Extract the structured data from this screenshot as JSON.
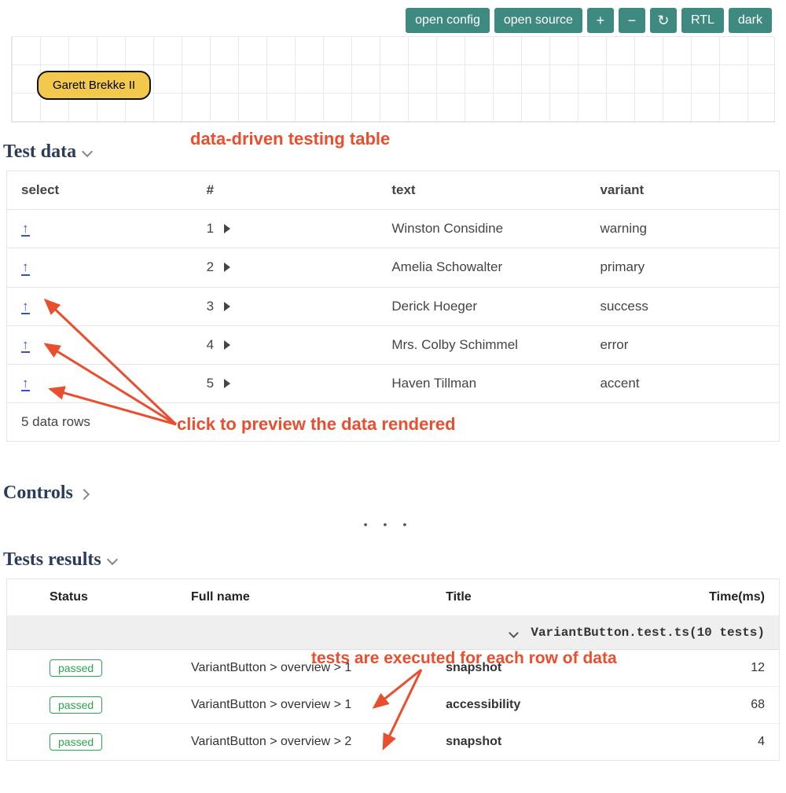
{
  "toolbar": {
    "open_config": "open config",
    "open_source": "open source",
    "plus": "+",
    "minus": "−",
    "reload": "↻",
    "rtl": "RTL",
    "dark": "dark"
  },
  "preview": {
    "button_label": "Garett Brekke II"
  },
  "annotations": {
    "table_title": "data-driven testing table",
    "click_preview": "click to preview the data rendered",
    "tests_each_row": "tests are executed for each row of data"
  },
  "test_data": {
    "section_title": "Test data",
    "headers": {
      "select": "select",
      "num": "#",
      "text": "text",
      "variant": "variant"
    },
    "rows": [
      {
        "num": "1",
        "text": "Winston Considine",
        "variant": "warning"
      },
      {
        "num": "2",
        "text": "Amelia Schowalter",
        "variant": "primary"
      },
      {
        "num": "3",
        "text": "Derick Hoeger",
        "variant": "success"
      },
      {
        "num": "4",
        "text": "Mrs. Colby Schimmel",
        "variant": "error"
      },
      {
        "num": "5",
        "text": "Haven Tillman",
        "variant": "accent"
      }
    ],
    "footer": "5 data rows"
  },
  "controls": {
    "section_title": "Controls"
  },
  "tests_results": {
    "section_title": "Tests results",
    "headers": {
      "status": "Status",
      "full_name": "Full name",
      "title": "Title",
      "time": "Time(ms)"
    },
    "group_label": "VariantButton.test.ts(10 tests)",
    "rows": [
      {
        "status": "passed",
        "full": "VariantButton > overview > 1",
        "title": "snapshot",
        "time": "12"
      },
      {
        "status": "passed",
        "full": "VariantButton > overview > 1",
        "title": "accessibility",
        "time": "68"
      },
      {
        "status": "passed",
        "full": "VariantButton > overview > 2",
        "title": "snapshot",
        "time": "4"
      }
    ]
  }
}
